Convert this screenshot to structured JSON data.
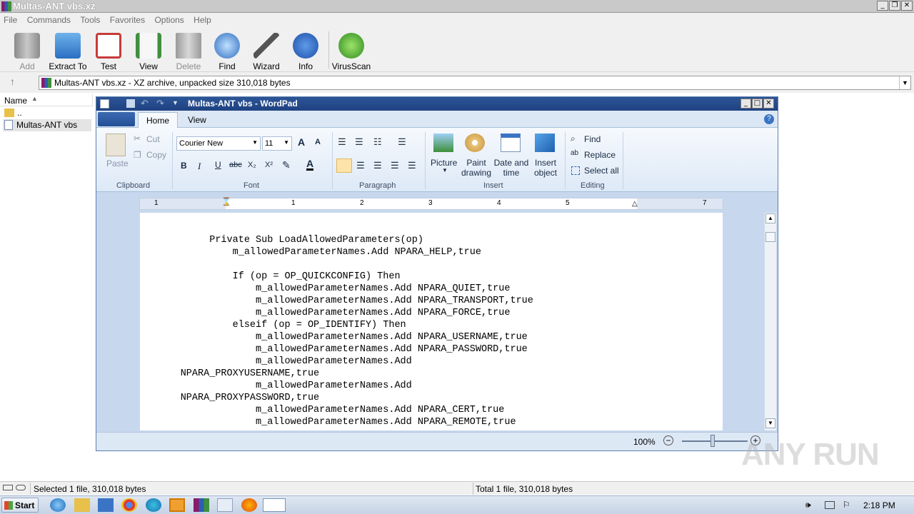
{
  "winrar": {
    "title": "Multas-ANT vbs.xz",
    "menu": [
      "File",
      "Commands",
      "Tools",
      "Favorites",
      "Options",
      "Help"
    ],
    "toolbar": [
      "Add",
      "Extract To",
      "Test",
      "View",
      "Delete",
      "Find",
      "Wizard",
      "Info",
      "VirusScan"
    ],
    "address": "Multas-ANT vbs.xz - XZ archive, unpacked size 310,018 bytes",
    "column_name": "Name",
    "files": [
      "..",
      "Multas-ANT vbs"
    ],
    "status_left": "Selected 1 file, 310,018 bytes",
    "status_right": "Total 1 file, 310,018 bytes"
  },
  "wordpad": {
    "title": "Multas-ANT vbs - WordPad",
    "tabs": [
      "Home",
      "View"
    ],
    "clipboard": {
      "paste": "Paste",
      "cut": "Cut",
      "copy": "Copy",
      "label": "Clipboard"
    },
    "font": {
      "family": "Courier New",
      "size": "11",
      "label": "Font"
    },
    "paragraph_label": "Paragraph",
    "insert": {
      "picture": "Picture",
      "paint_drawing": "Paint drawing",
      "date_time": "Date and time",
      "insert_object": "Insert object",
      "label": "Insert"
    },
    "editing": {
      "find": "Find",
      "replace": "Replace",
      "select_all": "Select all",
      "label": "Editing"
    },
    "ruler_numbers": [
      "1",
      "1",
      "2",
      "3",
      "4",
      "5",
      "7"
    ],
    "zoom": "100%",
    "document": [
      "            Private Sub LoadAllowedParameters(op)",
      "                m_allowedParameterNames.Add NPARA_HELP,true",
      "",
      "                If (op = OP_QUICKCONFIG) Then",
      "                    m_allowedParameterNames.Add NPARA_QUIET,true",
      "                    m_allowedParameterNames.Add NPARA_TRANSPORT,true",
      "                    m_allowedParameterNames.Add NPARA_FORCE,true",
      "                elseif (op = OP_IDENTIFY) Then",
      "                    m_allowedParameterNames.Add NPARA_USERNAME,true",
      "                    m_allowedParameterNames.Add NPARA_PASSWORD,true",
      "                    m_allowedParameterNames.Add",
      "       NPARA_PROXYUSERNAME,true",
      "                    m_allowedParameterNames.Add",
      "       NPARA_PROXYPASSWORD,true",
      "                    m_allowedParameterNames.Add NPARA_CERT,true",
      "                    m_allowedParameterNames.Add NPARA_REMOTE,true"
    ]
  },
  "taskbar": {
    "start": "Start",
    "clock": "2:18 PM"
  },
  "watermark": "ANY RUN"
}
